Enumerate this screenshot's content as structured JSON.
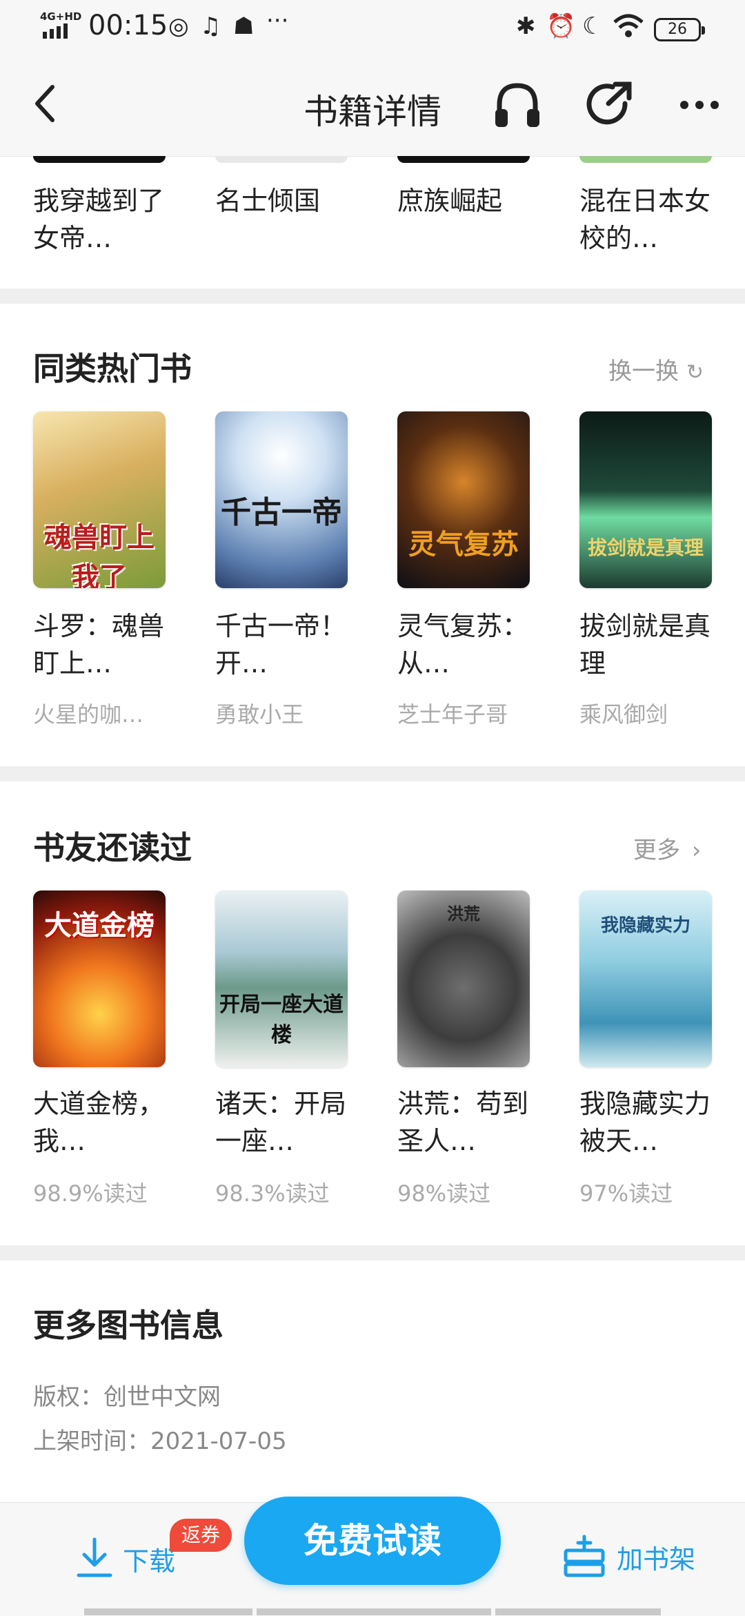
{
  "status_bar": {
    "network": "4G+HD",
    "time": "00:15",
    "more": "···",
    "battery": "26"
  },
  "header": {
    "title": "书籍详情",
    "back_icon": "chevron-left-icon",
    "audio_icon": "headphones-icon",
    "share_icon": "share-arrow-icon",
    "more_icon": "more-dots-icon"
  },
  "top_books": [
    {
      "title": "我穿越到了女帝…"
    },
    {
      "title": "名士倾国"
    },
    {
      "title": "庶族崛起"
    },
    {
      "title": "混在日本女校的…"
    }
  ],
  "similar": {
    "title": "同类热门书",
    "action": "换一换",
    "books": [
      {
        "title": "斗罗：魂兽盯上…",
        "author": "火星的咖…",
        "cover_text": "魂兽盯上我了"
      },
      {
        "title": "千古一帝！开…",
        "author": "勇敢小王",
        "cover_text": "千古一帝"
      },
      {
        "title": "灵气复苏：从…",
        "author": "芝士年子哥",
        "cover_text": "灵气复苏"
      },
      {
        "title": "拔剑就是真理",
        "author": "乘风御剑",
        "cover_text": "拔剑就是真理"
      }
    ]
  },
  "also_read": {
    "title": "书友还读过",
    "action": "更多",
    "books": [
      {
        "title": "大道金榜，我…",
        "rate": "98.9%读过",
        "cover_text": "大道金榜"
      },
      {
        "title": "诸天：开局一座…",
        "rate": "98.3%读过",
        "cover_text": "开局一座大道楼"
      },
      {
        "title": "洪荒：苟到圣人…",
        "rate": "98%读过",
        "cover_text": "洪荒"
      },
      {
        "title": "我隐藏实力被天…",
        "rate": "97%读过",
        "cover_text": "我隐藏实力"
      }
    ]
  },
  "more_info": {
    "title": "更多图书信息",
    "copyright": "版权：创世中文网",
    "release": "上架时间：2021-07-05"
  },
  "bottom_bar": {
    "download": "下载",
    "coupon": "返券",
    "trial": "免费试读",
    "add_shelf": "加书架"
  },
  "colors": {
    "accent": "#1aa8f2",
    "coupon": "#f04a3a"
  }
}
